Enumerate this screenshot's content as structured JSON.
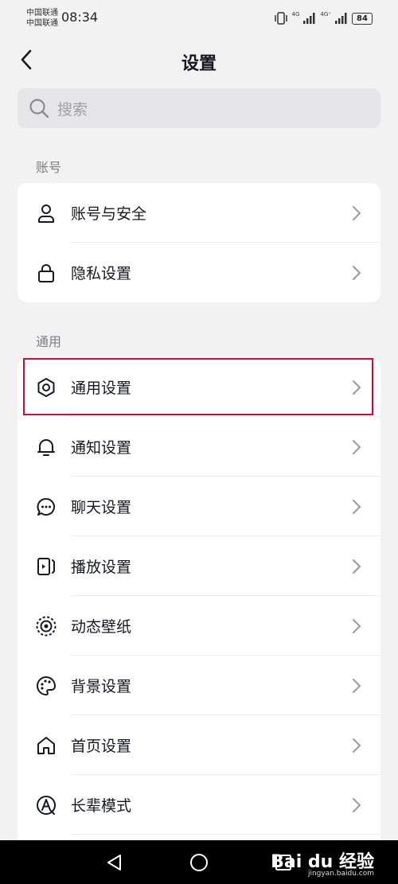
{
  "status_bar": {
    "carrier_1": "中国联通",
    "carrier_2": "中国联通",
    "time": "08:34",
    "network_1": "4G",
    "network_2": "4G⁺",
    "battery": "84"
  },
  "header": {
    "title": "设置"
  },
  "search": {
    "placeholder": "搜索"
  },
  "sections": [
    {
      "label": "账号",
      "items": [
        {
          "label": "账号与安全",
          "icon": "user-icon"
        },
        {
          "label": "隐私设置",
          "icon": "lock-icon"
        }
      ]
    },
    {
      "label": "通用",
      "items": [
        {
          "label": "通用设置",
          "icon": "gear-icon"
        },
        {
          "label": "通知设置",
          "icon": "bell-icon"
        },
        {
          "label": "聊天设置",
          "icon": "chat-icon"
        },
        {
          "label": "播放设置",
          "icon": "play-icon"
        },
        {
          "label": "动态壁纸",
          "icon": "wallpaper-icon"
        },
        {
          "label": "背景设置",
          "icon": "palette-icon"
        },
        {
          "label": "首页设置",
          "icon": "home-icon"
        },
        {
          "label": "长辈模式",
          "icon": "elder-mode-icon"
        }
      ]
    }
  ],
  "highlight_color": "#c8102e",
  "watermark": {
    "text": "Bai du 经验",
    "sub": "jingyan.baidu.com"
  }
}
